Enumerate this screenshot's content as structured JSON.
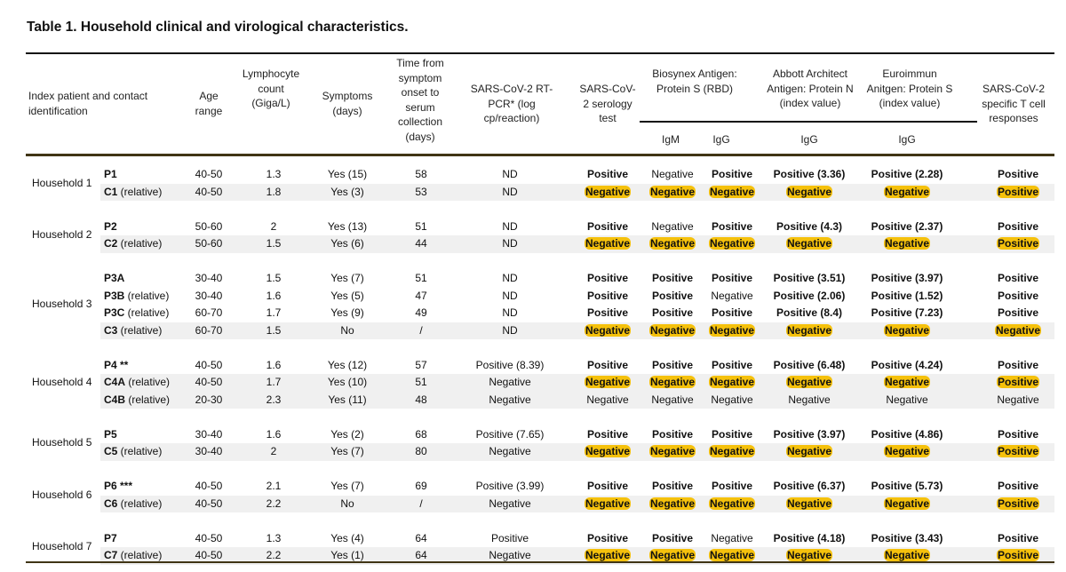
{
  "title": "Table 1. Household clinical and virological characteristics.",
  "header": {
    "id_col": "Index patient and contact identification",
    "age": "Age range",
    "lymph": "Lymphocyte count (Giga/L)",
    "symptoms": "Symptoms (days)",
    "time": "Time from symptom onset to serum collection (days)",
    "pcr": "SARS-CoV-2 RT-PCR* (log cp/reaction)",
    "serology": "SARS-CoV-2 serology test",
    "biosynex": "Biosynex Antigen: Protein S (RBD)",
    "abbott": "Abbott Architect Antigen: Protein N (index value)",
    "euroimmun": "Euroimmun Anitgen: Protein S (index value)",
    "tcell": "SARS-CoV-2 specific T cell responses",
    "sub_igm": "IgM",
    "sub_igg": "IgG"
  },
  "highlight_color": "#f5c10c",
  "households": [
    {
      "label": "Household 1",
      "rows": [
        {
          "id": "P1",
          "suffix": "",
          "age": "40-50",
          "lymph": "1.3",
          "symptoms": "Yes (15)",
          "time": "58",
          "pcr": "ND",
          "serology": "Positive",
          "igm": "Negative",
          "igg": "Positive",
          "abbott": "Positive (3.36)",
          "euro": "Positive (2.28)",
          "tcell": "Positive",
          "shade": false,
          "hl": false
        },
        {
          "id": "C1",
          "suffix": " (relative)",
          "age": "40-50",
          "lymph": "1.8",
          "symptoms": "Yes (3)",
          "time": "53",
          "pcr": "ND",
          "serology": "Negative",
          "igm": "Negative",
          "igg": "Negative",
          "abbott": "Negative",
          "euro": "Negative",
          "tcell": "Positive",
          "shade": true,
          "hl": true
        }
      ]
    },
    {
      "label": "Household 2",
      "rows": [
        {
          "id": "P2",
          "suffix": "",
          "age": "50-60",
          "lymph": "2",
          "symptoms": "Yes (13)",
          "time": "51",
          "pcr": "ND",
          "serology": "Positive",
          "igm": "Negative",
          "igg": "Positive",
          "abbott": "Positive (4.3)",
          "euro": "Positive (2.37)",
          "tcell": "Positive",
          "shade": false,
          "hl": false
        },
        {
          "id": "C2",
          "suffix": " (relative)",
          "age": "50-60",
          "lymph": "1.5",
          "symptoms": "Yes (6)",
          "time": "44",
          "pcr": "ND",
          "serology": "Negative",
          "igm": "Negative",
          "igg": "Negative",
          "abbott": "Negative",
          "euro": "Negative",
          "tcell": "Positive",
          "shade": true,
          "hl": true
        }
      ]
    },
    {
      "label": "Household 3",
      "rows": [
        {
          "id": "P3A",
          "suffix": "",
          "age": "30-40",
          "lymph": "1.5",
          "symptoms": "Yes (7)",
          "time": "51",
          "pcr": "ND",
          "serology": "Positive",
          "igm": "Positive",
          "igg": "Positive",
          "abbott": "Positive (3.51)",
          "euro": "Positive (3.97)",
          "tcell": "Positive",
          "shade": false,
          "hl": false
        },
        {
          "id": "P3B",
          "suffix": " (relative)",
          "age": "30-40",
          "lymph": "1.6",
          "symptoms": "Yes (5)",
          "time": "47",
          "pcr": "ND",
          "serology": "Positive",
          "igm": "Positive",
          "igg": "Negative",
          "abbott": "Positive (2.06)",
          "euro": "Positive (1.52)",
          "tcell": "Positive",
          "shade": false,
          "hl": false
        },
        {
          "id": "P3C",
          "suffix": " (relative)",
          "age": "60-70",
          "lymph": "1.7",
          "symptoms": "Yes (9)",
          "time": "49",
          "pcr": "ND",
          "serology": "Positive",
          "igm": "Positive",
          "igg": "Positive",
          "abbott": "Positive (8.4)",
          "euro": "Positive (7.23)",
          "tcell": "Positive",
          "shade": false,
          "hl": false
        },
        {
          "id": "C3",
          "suffix": " (relative)",
          "age": "60-70",
          "lymph": "1.5",
          "symptoms": "No",
          "time": "/",
          "pcr": "ND",
          "serology": "Negative",
          "igm": "Negative",
          "igg": "Negative",
          "abbott": "Negative",
          "euro": "Negative",
          "tcell": "Negative",
          "shade": true,
          "hl": true
        }
      ]
    },
    {
      "label": "Household 4",
      "rows": [
        {
          "id": "P4 **",
          "suffix": "",
          "age": "40-50",
          "lymph": "1.6",
          "symptoms": "Yes (12)",
          "time": "57",
          "pcr": "Positive (8.39)",
          "serology": "Positive",
          "igm": "Positive",
          "igg": "Positive",
          "abbott": "Positive (6.48)",
          "euro": "Positive (4.24)",
          "tcell": "Positive",
          "shade": false,
          "hl": false
        },
        {
          "id": "C4A",
          "suffix": " (relative)",
          "age": "40-50",
          "lymph": "1.7",
          "symptoms": "Yes (10)",
          "time": "51",
          "pcr": "Negative",
          "serology": "Negative",
          "igm": "Negative",
          "igg": "Negative",
          "abbott": "Negative",
          "euro": "Negative",
          "tcell": "Positive",
          "shade": true,
          "hl": true
        },
        {
          "id": "C4B",
          "suffix": " (relative)",
          "age": "20-30",
          "lymph": "2.3",
          "symptoms": "Yes (11)",
          "time": "48",
          "pcr": "Negative",
          "serology": "Negative",
          "igm": "Negative",
          "igg": "Negative",
          "abbott": "Negative",
          "euro": "Negative",
          "tcell": "Negative",
          "shade": true,
          "hl": false
        }
      ]
    },
    {
      "label": "Household 5",
      "rows": [
        {
          "id": "P5",
          "suffix": "",
          "age": "30-40",
          "lymph": "1.6",
          "symptoms": "Yes (2)",
          "time": "68",
          "pcr": "Positive (7.65)",
          "serology": "Positive",
          "igm": "Positive",
          "igg": "Positive",
          "abbott": "Positive (3.97)",
          "euro": "Positive (4.86)",
          "tcell": "Positive",
          "shade": false,
          "hl": false
        },
        {
          "id": "C5",
          "suffix": " (relative)",
          "age": "30-40",
          "lymph": "2",
          "symptoms": "Yes (7)",
          "time": "80",
          "pcr": "Negative",
          "serology": "Negative",
          "igm": "Negative",
          "igg": "Negative",
          "abbott": "Negative",
          "euro": "Negative",
          "tcell": "Positive",
          "shade": true,
          "hl": true
        }
      ]
    },
    {
      "label": "Household 6",
      "rows": [
        {
          "id": "P6 ***",
          "suffix": "",
          "age": "40-50",
          "lymph": "2.1",
          "symptoms": "Yes (7)",
          "time": "69",
          "pcr": "Positive (3.99)",
          "serology": "Positive",
          "igm": "Positive",
          "igg": "Positive",
          "abbott": "Positive (6.37)",
          "euro": "Positive (5.73)",
          "tcell": "Positive",
          "shade": false,
          "hl": false
        },
        {
          "id": "C6",
          "suffix": " (relative)",
          "age": "40-50",
          "lymph": "2.2",
          "symptoms": "No",
          "time": "/",
          "pcr": "Negative",
          "serology": "Negative",
          "igm": "Negative",
          "igg": "Negative",
          "abbott": "Negative",
          "euro": "Negative",
          "tcell": "Positive",
          "shade": true,
          "hl": true
        }
      ]
    },
    {
      "label": "Household 7",
      "rows": [
        {
          "id": "P7",
          "suffix": "",
          "age": "40-50",
          "lymph": "1.3",
          "symptoms": "Yes (4)",
          "time": "64",
          "pcr": "Positive",
          "serology": "Positive",
          "igm": "Positive",
          "igg": "Negative",
          "abbott": "Positive (4.18)",
          "euro": "Positive (3.43)",
          "tcell": "Positive",
          "shade": false,
          "hl": false
        },
        {
          "id": "C7",
          "suffix": " (relative)",
          "age": "40-50",
          "lymph": "2.2",
          "symptoms": "Yes (1)",
          "time": "64",
          "pcr": "Negative",
          "serology": "Negative",
          "igm": "Negative",
          "igg": "Negative",
          "abbott": "Negative",
          "euro": "Negative",
          "tcell": "Positive",
          "shade": true,
          "hl": true
        }
      ]
    }
  ]
}
